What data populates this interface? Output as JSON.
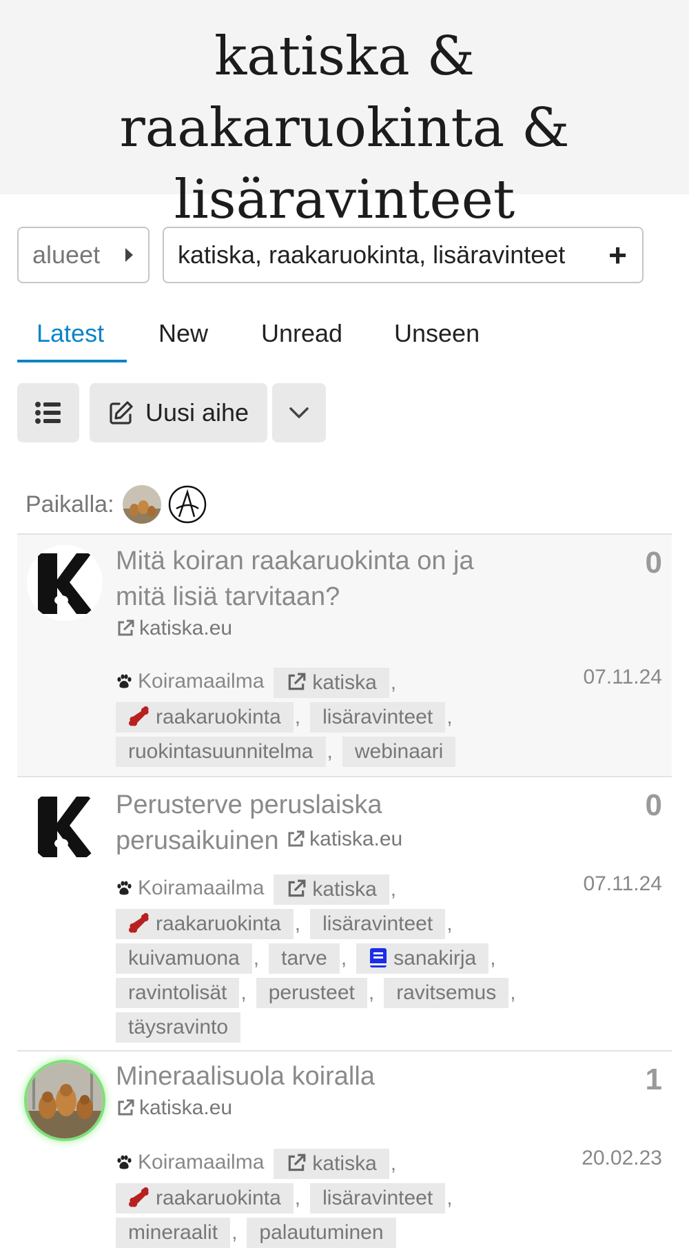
{
  "banner": {
    "title": "katiska & raakaruokinta & lisäravinteet"
  },
  "filters": {
    "categories_label": "alueet",
    "tags_value": "katiska, raakaruokinta, lisäravinteet"
  },
  "nav": {
    "tabs": [
      "Latest",
      "New",
      "Unread",
      "Unseen"
    ],
    "active": "Latest"
  },
  "toolbar": {
    "new_topic_label": "Uusi aihe"
  },
  "online": {
    "label": "Paikalla:"
  },
  "colors": {
    "accent": "#0a84c6",
    "tag_icon_red": "#b82020",
    "tag_icon_blue": "#1a2ee8"
  },
  "topics": [
    {
      "title": "Mitä koiran raakaruokinta on ja mitä lisiä tarvitaan?",
      "link": "katiska.eu",
      "category": "Koiramaailma",
      "tags": [
        "katiska",
        "raakaruokinta",
        "lisäravinteet",
        "ruokintasuunnitelma",
        "webinaari"
      ],
      "replies": "0",
      "date": "07.11.24"
    },
    {
      "title": "Perusterve peruslaiska perusaikuinen",
      "link": "katiska.eu",
      "category": "Koiramaailma",
      "tags": [
        "katiska",
        "raakaruokinta",
        "lisäravinteet",
        "kuivamuona",
        "tarve",
        "sanakirja",
        "ravintolisät",
        "perusteet",
        "ravitsemus",
        "täysravinto"
      ],
      "replies": "0",
      "date": "07.11.24"
    },
    {
      "title": "Mineraalisuola koiralla",
      "link": "katiska.eu",
      "category": "Koiramaailma",
      "tags": [
        "katiska",
        "raakaruokinta",
        "lisäravinteet",
        "mineraalit",
        "palautuminen"
      ],
      "replies": "1",
      "date": "20.02.23"
    }
  ]
}
